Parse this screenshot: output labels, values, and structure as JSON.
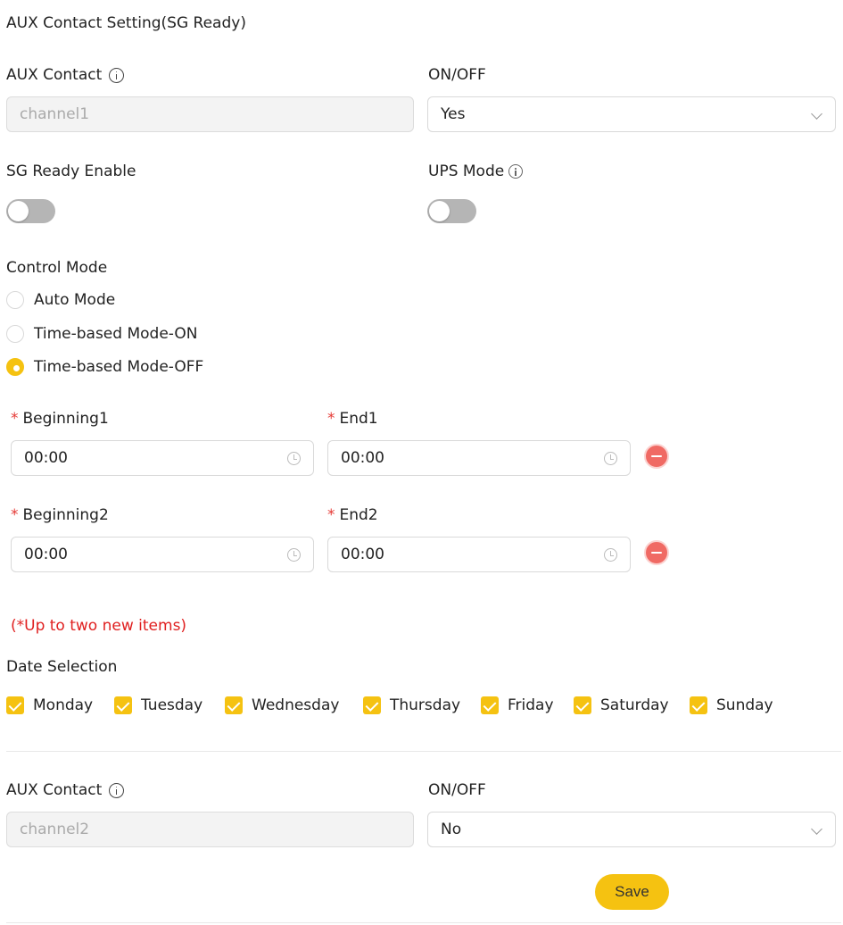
{
  "header": {
    "title": "AUX Contact Setting(SG Ready)"
  },
  "channel1": {
    "aux_label": "AUX Contact",
    "aux_value": "channel1",
    "onoff_label": "ON/OFF",
    "onoff_value": "Yes",
    "sg_ready_label": "SG Ready Enable",
    "sg_ready_enabled": false,
    "ups_label": "UPS Mode",
    "ups_enabled": false,
    "control_mode_label": "Control Mode",
    "modes": [
      {
        "label": "Auto Mode",
        "selected": false
      },
      {
        "label": "Time-based Mode-ON",
        "selected": false
      },
      {
        "label": "Time-based Mode-OFF",
        "selected": true
      }
    ],
    "periods": [
      {
        "begin_label": "Beginning1",
        "begin_value": "00:00",
        "end_label": "End1",
        "end_value": "00:00"
      },
      {
        "begin_label": "Beginning2",
        "begin_value": "00:00",
        "end_label": "End2",
        "end_value": "00:00"
      }
    ],
    "required_mark": "*",
    "limit_note": "(*Up to two new items)",
    "date_label": "Date Selection",
    "days": [
      {
        "label": "Monday",
        "checked": true
      },
      {
        "label": "Tuesday",
        "checked": true
      },
      {
        "label": "Wednesday",
        "checked": true
      },
      {
        "label": "Thursday",
        "checked": true
      },
      {
        "label": "Friday",
        "checked": true
      },
      {
        "label": "Saturday",
        "checked": true
      },
      {
        "label": "Sunday",
        "checked": true
      }
    ]
  },
  "channel2": {
    "aux_label": "AUX Contact",
    "aux_value": "channel2",
    "onoff_label": "ON/OFF",
    "onoff_value": "No"
  },
  "actions": {
    "save_label": "Save"
  },
  "colors": {
    "accent": "#f5c211",
    "danger": "#e02020",
    "remove": "#f06a64"
  }
}
